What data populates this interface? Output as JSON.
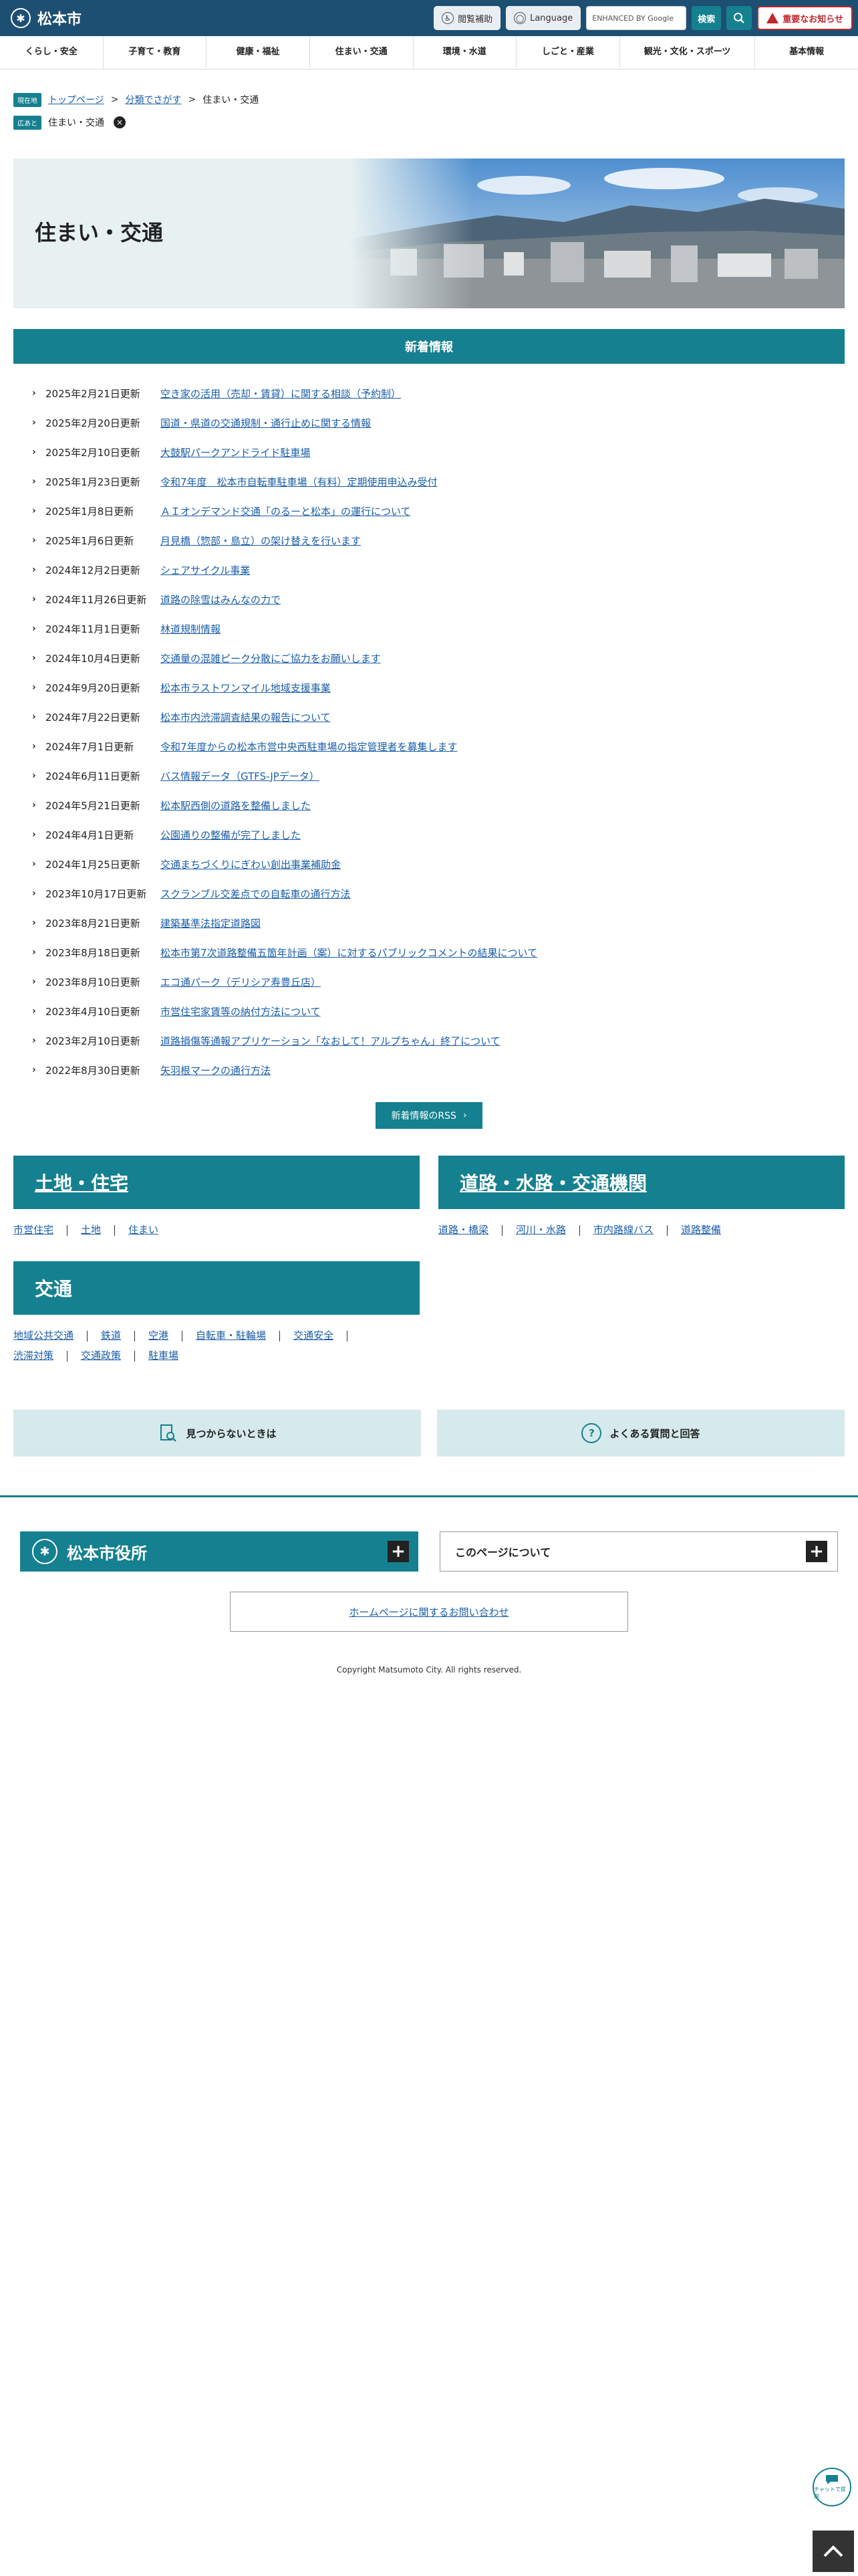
{
  "header": {
    "site_name": "松本市",
    "reading_aid": "閲覧補助",
    "language": "Language",
    "search_placeholder": "ENHANCED BY Google",
    "search_button": "検索",
    "important_notice": "重要なお知らせ"
  },
  "nav": [
    "くらし・安全",
    "子育て・教育",
    "健康・福祉",
    "住まい・交通",
    "環境・水道",
    "しごと・産業",
    "観光・文化・スポーツ",
    "基本情報"
  ],
  "breadcrumb": {
    "current_label": "現在地",
    "trail": [
      "トップページ",
      "分類でさがす",
      "住まい・交通"
    ],
    "filter_label": "広あと",
    "filter_value": "住まい・交通"
  },
  "hero": {
    "title": "住まい・交通"
  },
  "news": {
    "heading": "新着情報",
    "items": [
      {
        "date": "2025年2月21日更新",
        "title": "空き家の活用（売却・賃貸）に関する相談（予約制）"
      },
      {
        "date": "2025年2月20日更新",
        "title": "国道・県道の交通規制・通行止めに関する情報"
      },
      {
        "date": "2025年2月10日更新",
        "title": "大鼓駅パークアンドライド駐車場"
      },
      {
        "date": "2025年1月23日更新",
        "title": "令和7年度　松本市自転車駐車場（有料）定期使用申込み受付"
      },
      {
        "date": "2025年1月8日更新",
        "title": "ＡＩオンデマンド交通「のるーと松本」の運行について"
      },
      {
        "date": "2025年1月6日更新",
        "title": "月見橋（惣部・島立）の架け替えを行います"
      },
      {
        "date": "2024年12月2日更新",
        "title": "シェアサイクル事業"
      },
      {
        "date": "2024年11月26日更新",
        "title": "道路の除雪はみんなの力で"
      },
      {
        "date": "2024年11月1日更新",
        "title": "林道規制情報"
      },
      {
        "date": "2024年10月4日更新",
        "title": "交通量の混雑ピーク分散にご協力をお願いします"
      },
      {
        "date": "2024年9月20日更新",
        "title": "松本市ラストワンマイル地域支援事業"
      },
      {
        "date": "2024年7月22日更新",
        "title": "松本市内渋滞調査結果の報告について"
      },
      {
        "date": "2024年7月1日更新",
        "title": "令和7年度からの松本市営中央西駐車場の指定管理者を募集します"
      },
      {
        "date": "2024年6月11日更新",
        "title": "バス情報データ（GTFS-JPデータ）"
      },
      {
        "date": "2024年5月21日更新",
        "title": "松本駅西側の道路を整備しました"
      },
      {
        "date": "2024年4月1日更新",
        "title": "公園通りの整備が完了しました"
      },
      {
        "date": "2024年1月25日更新",
        "title": "交通まちづくりにぎわい創出事業補助金"
      },
      {
        "date": "2023年10月17日更新",
        "title": "スクランブル交差点での自転車の通行方法"
      },
      {
        "date": "2023年8月21日更新",
        "title": "建築基準法指定道路図"
      },
      {
        "date": "2023年8月18日更新",
        "title": "松本市第7次道路整備五箇年計画（案）に対するパブリックコメントの結果について"
      },
      {
        "date": "2023年8月10日更新",
        "title": "エコ通パーク（デリシア寿豊丘店）"
      },
      {
        "date": "2023年4月10日更新",
        "title": "市営住宅家賃等の納付方法について"
      },
      {
        "date": "2023年2月10日更新",
        "title": "道路損傷等通報アプリケーション「なおして！アルプちゃん」終了について"
      },
      {
        "date": "2022年8月30日更新",
        "title": "矢羽根マークの通行方法"
      }
    ],
    "rss_label": "新着情報のRSS"
  },
  "categories": {
    "land": {
      "title": "土地・住宅",
      "links": [
        "市営住宅",
        "土地",
        "住まい"
      ]
    },
    "roads": {
      "title": "道路・水路・交通機関",
      "links": [
        "道路・橋梁",
        "河川・水路",
        "市内路線バス",
        "道路整備"
      ]
    },
    "traffic": {
      "title": "交通",
      "links_row1": [
        "地域公共交通",
        "鉄道",
        "空港",
        "自転車・駐輪場",
        "交通安全"
      ],
      "links_row2": [
        "渋滞対策",
        "交通政策",
        "駐車場"
      ]
    }
  },
  "help": {
    "not_found": "見つからないときは",
    "faq": "よくある質問と回答"
  },
  "footer": {
    "city_office": "松本市役所",
    "about_page": "このページについて",
    "contact": "ホームページに関するお問い合わせ",
    "copyright": "Copyright Matsumoto City. All rights reserved."
  },
  "chat_label": "チャットで質問"
}
